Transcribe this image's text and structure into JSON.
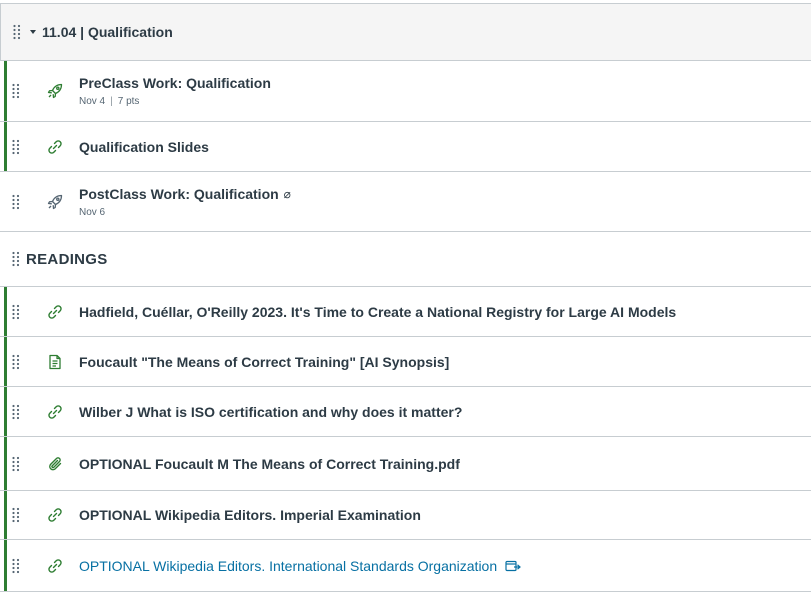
{
  "module": {
    "title": "11.04 | Qualification",
    "items": [
      {
        "kind": "assignment",
        "icon": "rocket-icon",
        "title": "PreClass Work: Qualification",
        "date": "Nov 4",
        "points": "7 pts",
        "published": true
      },
      {
        "kind": "link",
        "icon": "link-icon",
        "title": "Qualification Slides",
        "published": true
      },
      {
        "kind": "assignment",
        "icon": "rocket-icon",
        "title": "PostClass Work: Qualification",
        "status_symbol": "⌀",
        "date": "Nov 6",
        "published": false
      },
      {
        "kind": "header",
        "title": "READINGS"
      },
      {
        "kind": "link",
        "icon": "link-icon",
        "title": "Hadfield, Cuéllar, O'Reilly 2023. It's Time to Create a National Registry for Large AI Models",
        "published": true
      },
      {
        "kind": "page",
        "icon": "document-icon",
        "title": "Foucault \"The Means of Correct Training\" [AI Synopsis]",
        "published": true
      },
      {
        "kind": "link",
        "icon": "link-icon",
        "title": "Wilber J What is ISO certification and why does it matter?",
        "published": true
      },
      {
        "kind": "file",
        "icon": "paperclip-icon",
        "title": "OPTIONAL Foucault M The Means of Correct Training.pdf",
        "published": true
      },
      {
        "kind": "link",
        "icon": "link-icon",
        "title": "OPTIONAL Wikipedia Editors. Imperial Examination",
        "published": true
      },
      {
        "kind": "external-link",
        "icon": "link-icon",
        "title": "OPTIONAL Wikipedia Editors. International Standards Organization",
        "published": true
      }
    ]
  },
  "colors": {
    "published_bar": "#2e7d32",
    "icon_green": "#2e7d32",
    "icon_gray": "#556572",
    "link_blue": "#0770a3"
  }
}
